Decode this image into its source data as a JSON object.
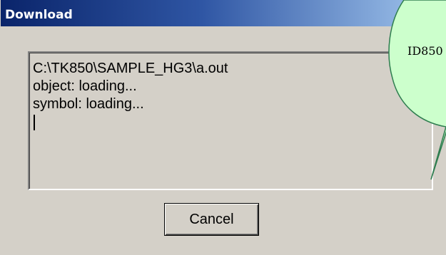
{
  "window": {
    "title": "Download"
  },
  "log": {
    "lines": [
      "C:\\TK850\\SAMPLE_HG3\\a.out",
      "object: loading...",
      "symbol: loading..."
    ]
  },
  "buttons": {
    "cancel_label": "Cancel"
  },
  "tooltip": {
    "text": "ID850"
  },
  "colors": {
    "titlebar_start": "#0a246a",
    "titlebar_end": "#a6caf0",
    "dialog_background": "#d4d0c8",
    "tooltip_fill": "#ccffcc",
    "tooltip_border": "#2e7d4f"
  }
}
